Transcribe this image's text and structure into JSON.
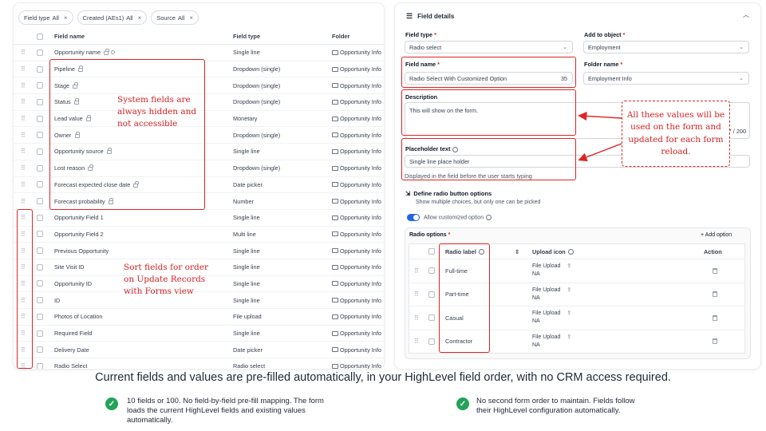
{
  "filters": [
    {
      "label": "Field type",
      "value": "All"
    },
    {
      "label": "Created (AEs1)",
      "value": "All"
    },
    {
      "label": "Source",
      "value": "All"
    }
  ],
  "table": {
    "columns": [
      "Field name",
      "Field type",
      "Folder"
    ],
    "rows": [
      {
        "name": "Opportunity name",
        "type": "Single line",
        "folder": "Opportunity Info"
      },
      {
        "name": "Pipeline",
        "type": "Dropdown (single)",
        "folder": "Opportunity Info"
      },
      {
        "name": "Stage",
        "type": "Dropdown (single)",
        "folder": "Opportunity Info"
      },
      {
        "name": "Status",
        "type": "Dropdown (single)",
        "folder": "Opportunity Info"
      },
      {
        "name": "Lead value",
        "type": "Monetary",
        "folder": "Opportunity Info"
      },
      {
        "name": "Owner",
        "type": "Dropdown (single)",
        "folder": "Opportunity Info"
      },
      {
        "name": "Opportunity source",
        "type": "Single line",
        "folder": "Opportunity Info"
      },
      {
        "name": "Lost reason",
        "type": "Dropdown (single)",
        "folder": "Opportunity Info"
      },
      {
        "name": "Forecast expected close date",
        "type": "Date picker",
        "folder": "Opportunity Info"
      },
      {
        "name": "Forecast probability",
        "type": "Number",
        "folder": "Opportunity Info"
      },
      {
        "name": "Opportunity Field 1",
        "type": "Single line",
        "folder": "Opportunity Info"
      },
      {
        "name": "Opportunity Field 2",
        "type": "Multi line",
        "folder": "Opportunity Info"
      },
      {
        "name": "Previous Opportunity",
        "type": "Single line",
        "folder": "Opportunity Info"
      },
      {
        "name": "Site Visit ID",
        "type": "Single line",
        "folder": "Opportunity Info"
      },
      {
        "name": "Opportunity ID",
        "type": "Single line",
        "folder": "Opportunity Info"
      },
      {
        "name": "ID",
        "type": "Single line",
        "folder": "Opportunity Info"
      },
      {
        "name": "Photos of Location",
        "type": "File upload",
        "folder": "Opportunity Info"
      },
      {
        "name": "Required Field",
        "type": "Single line",
        "folder": "Opportunity Info"
      },
      {
        "name": "Delivery Date",
        "type": "Date picker",
        "folder": "Opportunity Info"
      },
      {
        "name": "Radio Select",
        "type": "Radio select",
        "folder": "Opportunity Info"
      }
    ]
  },
  "notes": {
    "system_fields": "System fields are always hidden and not accessible",
    "sort_fields": "Sort fields for order on Update Records with Forms view",
    "values_used": "All these values will be used on the form and updated for each form reload."
  },
  "details": {
    "title": "Field details",
    "field_type_label": "Field type",
    "field_type_value": "Radio select",
    "add_to_object_label": "Add to object",
    "add_to_object_value": "Employment",
    "field_name_label": "Field name",
    "field_name_value": "Radio Select With Customized Option",
    "field_name_count": "35",
    "folder_name_label": "Folder name",
    "folder_name_value": "Employment Info",
    "description_label": "Description",
    "description_value": "This will show on the form.",
    "description_count": "27 / 200",
    "placeholder_label": "Placeholder text",
    "placeholder_value": "Single line place holder",
    "placeholder_hint": "Displayed in the field before the user starts typing",
    "define_title": "Define radio button options",
    "define_sub": "Show multiple choices, but only one can be picked",
    "allow_custom": "Allow customized option",
    "radio_options_label": "Radio options",
    "add_option": "+ Add option",
    "radio_cols": [
      "Radio label",
      "Upload icon",
      "Action"
    ],
    "radio_rows": [
      {
        "label": "Full-time",
        "upload": "File Upload",
        "na": "NA"
      },
      {
        "label": "Part-time",
        "upload": "File Upload",
        "na": "NA"
      },
      {
        "label": "Casual",
        "upload": "File Upload",
        "na": "NA"
      },
      {
        "label": "Contractor",
        "upload": "File Upload",
        "na": "NA"
      }
    ]
  },
  "footer": {
    "caption": "Current fields and values are pre-filled automatically, in your HighLevel field order, with no CRM access required.",
    "bullet1": "10 fields or 100. No field-by-field pre-fill mapping. The form loads the current HighLevel fields and existing values automatically.",
    "bullet2": "No second form order to maintain. Fields follow their HighLevel configuration automatically."
  },
  "colors": {
    "accent": "#2563eb",
    "annotation": "#e02424",
    "check": "#22a35a"
  }
}
